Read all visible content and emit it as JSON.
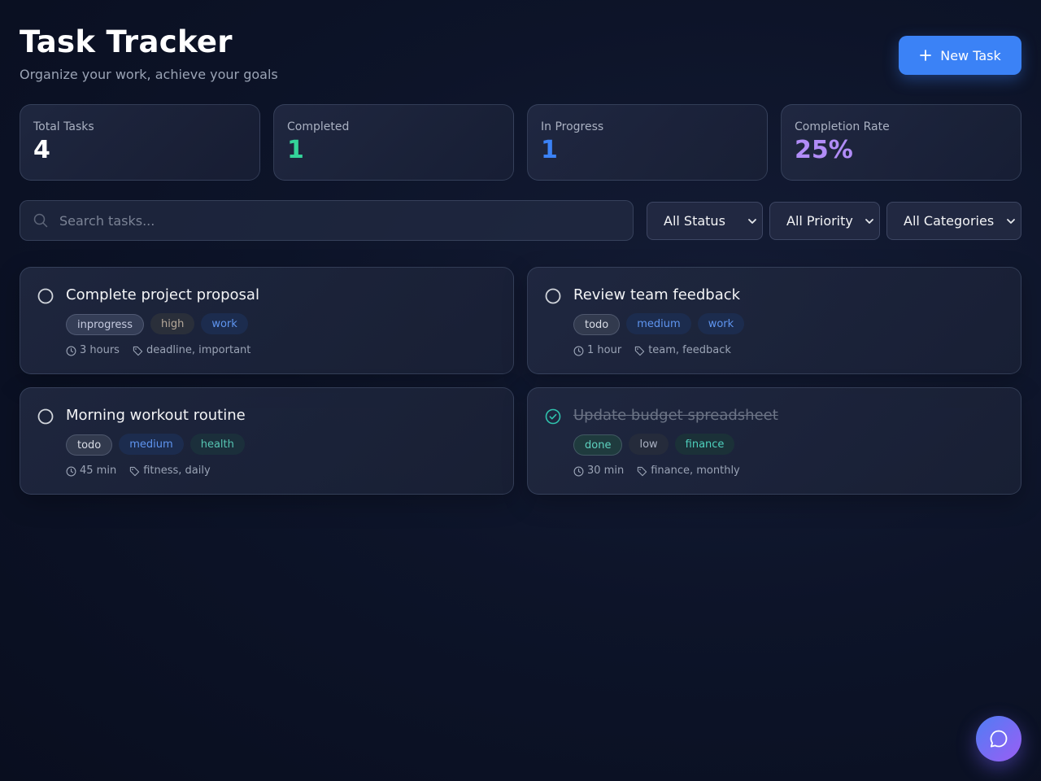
{
  "header": {
    "title": "Task Tracker",
    "subtitle": "Organize your work, achieve your goals",
    "new_task_label": "New Task"
  },
  "stats": [
    {
      "label": "Total Tasks",
      "value": "4",
      "color": "#ffffff"
    },
    {
      "label": "Completed",
      "value": "1",
      "color": "#34d399"
    },
    {
      "label": "In Progress",
      "value": "1",
      "color": "#3b82f6"
    },
    {
      "label": "Completion Rate",
      "value": "25%",
      "color": "#b18cf7"
    }
  ],
  "filters": {
    "search_placeholder": "Search tasks...",
    "status": "All Status",
    "priority": "All Priority",
    "category": "All Categories"
  },
  "tasks": [
    {
      "title": "Complete project proposal",
      "status": "inprogress",
      "priority": "high",
      "category": "work",
      "duration": "3 hours",
      "tags": "deadline, important",
      "done": false
    },
    {
      "title": "Review team feedback",
      "status": "todo",
      "priority": "medium",
      "category": "work",
      "duration": "1 hour",
      "tags": "team, feedback",
      "done": false
    },
    {
      "title": "Morning workout routine",
      "status": "todo",
      "priority": "medium",
      "category": "health",
      "duration": "45 min",
      "tags": "fitness, daily",
      "done": false
    },
    {
      "title": "Update budget spreadsheet",
      "status": "done",
      "priority": "low",
      "category": "finance",
      "duration": "30 min",
      "tags": "finance, monthly",
      "done": true
    }
  ],
  "icons": {
    "new_task": "plus-icon",
    "search": "search-icon",
    "select": "chevron-down-icon",
    "check_open": "circle-icon",
    "check_done": "check-circle-icon",
    "duration": "clock-icon",
    "tags": "tag-icon",
    "chat": "chat-bubble-icon"
  }
}
